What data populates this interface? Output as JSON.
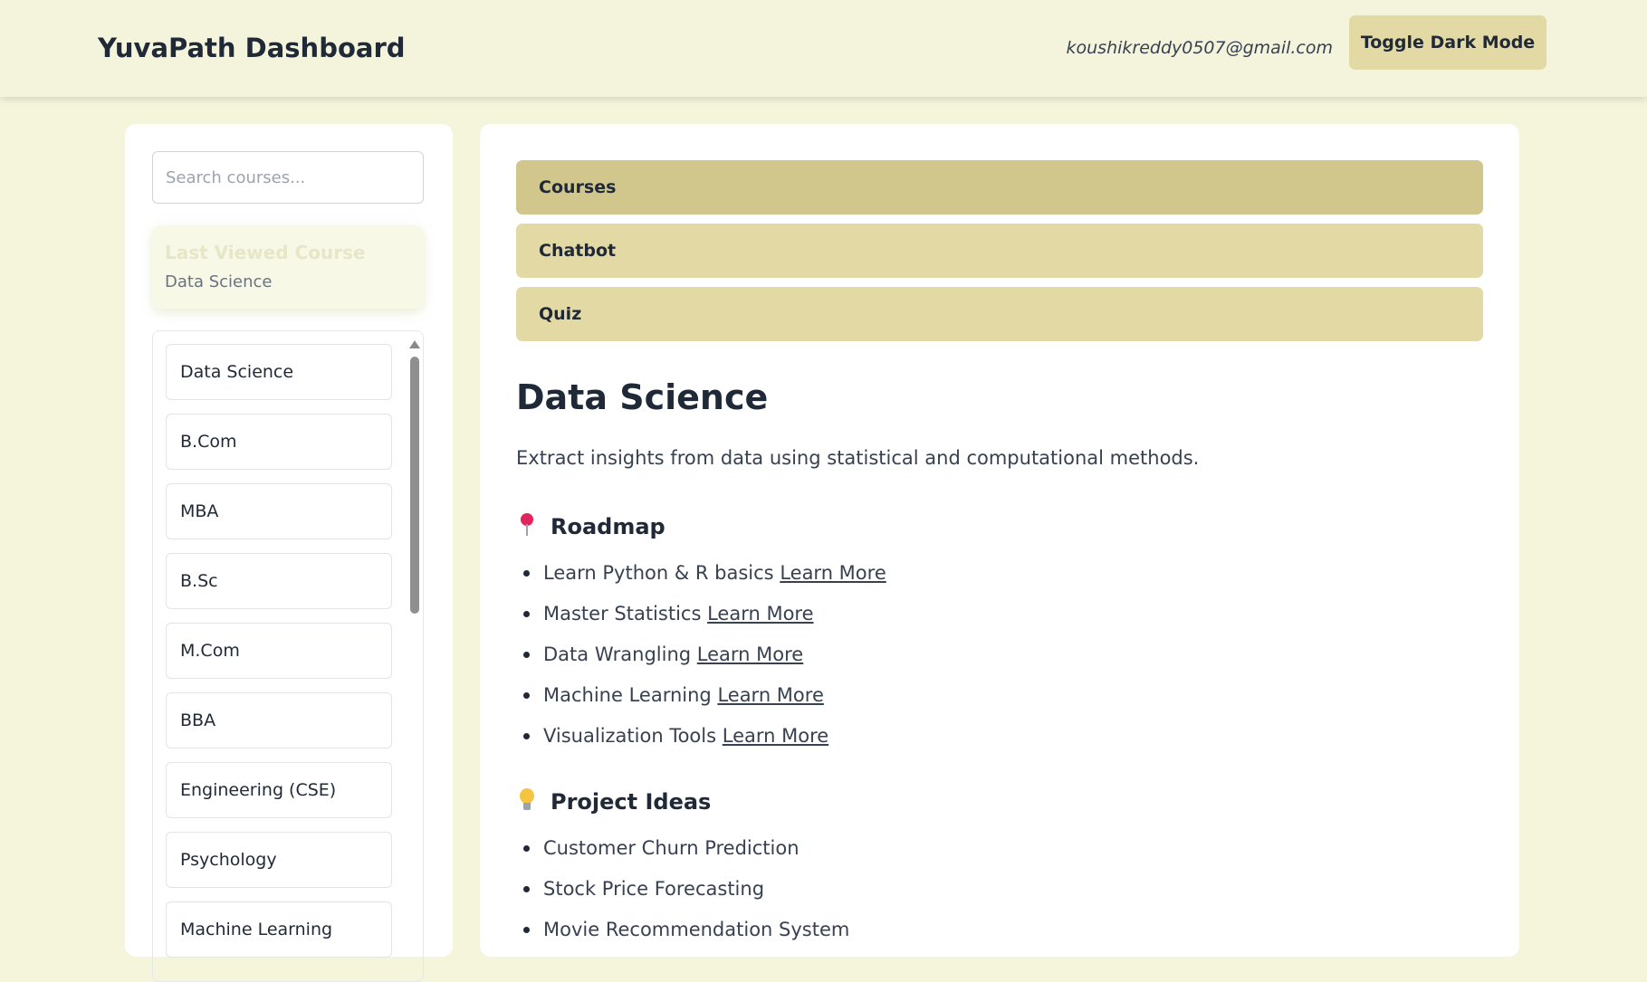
{
  "header": {
    "brand": "YuvaPath Dashboard",
    "user_email": "koushikreddy0507@gmail.com",
    "toggle_label": "Toggle Dark Mode"
  },
  "sidebar": {
    "search_placeholder": "Search courses...",
    "last_viewed": {
      "title": "Last Viewed Course",
      "course": "Data Science"
    },
    "courses": [
      "Data Science",
      "B.Com",
      "MBA",
      "B.Sc",
      "M.Com",
      "BBA",
      "Engineering (CSE)",
      "Psychology",
      "Machine Learning"
    ]
  },
  "tabs": {
    "courses": "Courses",
    "chatbot": "Chatbot",
    "quiz": "Quiz"
  },
  "course": {
    "title": "Data Science",
    "description": "Extract insights from data using statistical and computational methods.",
    "roadmap_heading": "Roadmap",
    "roadmap_icon": "pin-icon",
    "learn_more_label": "Learn More",
    "roadmap": [
      "Learn Python & R basics",
      "Master Statistics",
      "Data Wrangling",
      "Machine Learning",
      "Visualization Tools"
    ],
    "projects_heading": "Project Ideas",
    "projects_icon": "bulb-icon",
    "projects": [
      "Customer Churn Prediction",
      "Stock Price Forecasting",
      "Movie Recommendation System"
    ]
  },
  "colors": {
    "background": "#f5f5dc",
    "tab_active": "#d1c68c",
    "tab_inactive": "#e3d9a5",
    "pin": "#e0245e",
    "bulb": "#f5c542"
  }
}
